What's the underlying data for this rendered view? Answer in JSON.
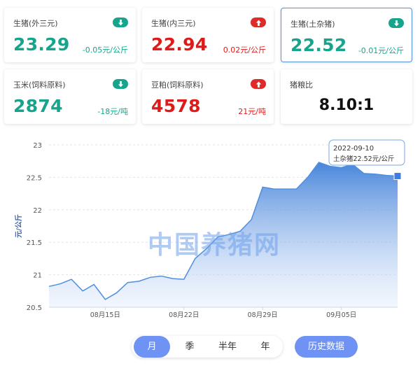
{
  "cards": [
    {
      "name": "生猪(外三元)",
      "price": "23.29",
      "change": "-0.05元/公斤",
      "direction": "down"
    },
    {
      "name": "生猪(内三元)",
      "price": "22.94",
      "change": "0.02元/公斤",
      "direction": "up"
    },
    {
      "name": "生猪(土杂猪)",
      "price": "22.52",
      "change": "-0.01元/公斤",
      "direction": "down",
      "selected": true
    },
    {
      "name": "玉米(饲料原料)",
      "price": "2874",
      "change": "-18元/吨",
      "direction": "down"
    },
    {
      "name": "豆粕(饲料原料)",
      "price": "4578",
      "change": "21元/吨",
      "direction": "up"
    },
    {
      "name": "猪粮比",
      "price": "8.10:1",
      "direction": "none"
    }
  ],
  "colors": {
    "down": "#16a58c",
    "up": "#de1b1b",
    "accent": "#6f93f5",
    "line": "#4e8fe0"
  },
  "icons": {
    "down": "arrow-down-icon",
    "up": "arrow-up-icon"
  },
  "chart_data": {
    "type": "area",
    "ylabel": "元/公斤",
    "ylim": [
      20.5,
      23
    ],
    "yticks": [
      "20.5",
      "21",
      "21.5",
      "22",
      "22.5",
      "23"
    ],
    "x_tick_labels": [
      "08月15日",
      "08月22日",
      "08月29日",
      "09月05日"
    ],
    "x": [
      "08-10",
      "08-11",
      "08-12",
      "08-13",
      "08-14",
      "08-15",
      "08-16",
      "08-17",
      "08-18",
      "08-19",
      "08-20",
      "08-21",
      "08-22",
      "08-23",
      "08-24",
      "08-25",
      "08-26",
      "08-27",
      "08-28",
      "08-29",
      "08-30",
      "08-31",
      "09-01",
      "09-02",
      "09-03",
      "09-04",
      "09-05",
      "09-06",
      "09-07",
      "09-08",
      "09-09",
      "09-10"
    ],
    "series": [
      {
        "values": [
          20.82,
          20.86,
          20.93,
          20.75,
          20.85,
          20.62,
          20.72,
          20.88,
          20.9,
          20.96,
          20.98,
          20.94,
          20.93,
          21.25,
          21.4,
          21.58,
          21.62,
          21.67,
          21.85,
          22.35,
          22.32,
          22.32,
          22.32,
          22.5,
          22.73,
          22.67,
          22.65,
          22.7,
          22.56,
          22.55,
          22.53,
          22.52
        ]
      }
    ],
    "watermark": "中国养猪网",
    "tooltip": {
      "date": "2022-09-10",
      "text": "土杂猪22.52元/公斤"
    },
    "grid": true
  },
  "tabs": [
    "月",
    "季",
    "半年",
    "年"
  ],
  "active_tab": "月",
  "history_button": "历史数据"
}
